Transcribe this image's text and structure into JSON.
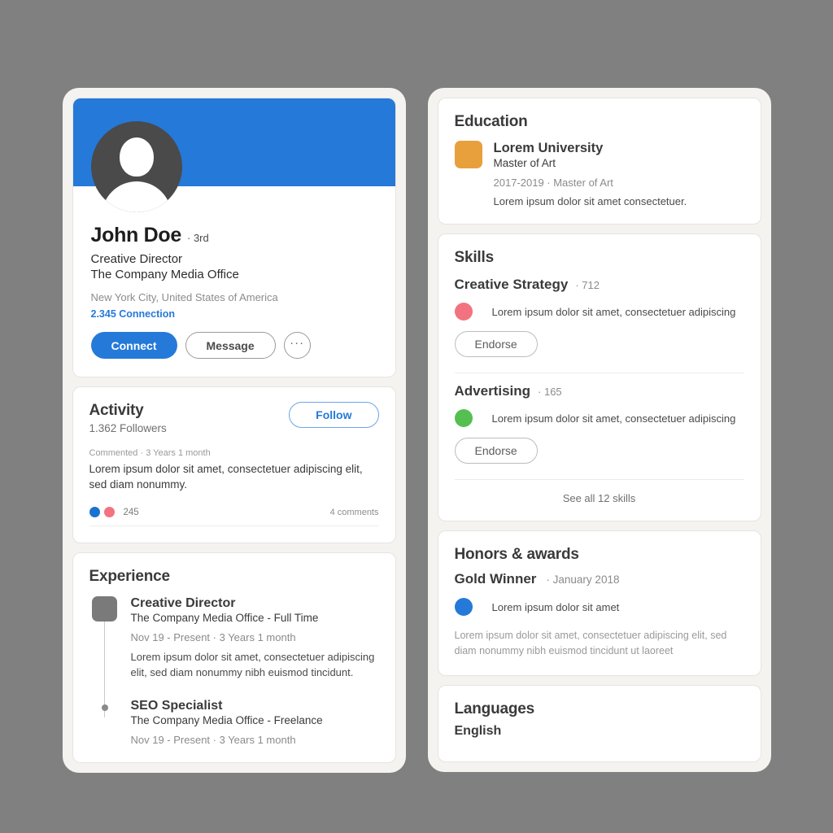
{
  "colors": {
    "brand_blue": "#2579D9",
    "page_background": "#808080",
    "panel_background": "#F4F3F0",
    "card_background": "#FFFFFF",
    "education_logo": "#E8A03C",
    "experience_logo": "#7A7A7A",
    "avatar": "#4A4A4A",
    "skill_dot_1": "#F2737F",
    "skill_dot_2": "#55BF52",
    "honor_dot": "#2579D9",
    "reaction_like": "#1A72D0",
    "reaction_love": "#F2737F"
  },
  "profile": {
    "name": "John Doe",
    "degree": "· 3rd",
    "headline_line1": "Creative Director",
    "headline_line2": "The Company Media Office",
    "location": "New York City, United States of America",
    "connections": "2.345 Connection",
    "connect_label": "Connect",
    "message_label": "Message",
    "more_label": "···"
  },
  "activity": {
    "title": "Activity",
    "follow_label": "Follow",
    "followers": "1.362 Followers",
    "meta": "Commented · 3 Years 1 month",
    "post_text": "Lorem ipsum dolor sit amet, consectetuer adipiscing elit, sed diam nonummy.",
    "reaction_count": "245",
    "comments_count": "4 comments"
  },
  "experience": {
    "title": "Experience",
    "items": [
      {
        "role": "Creative Director",
        "company": "The Company Media Office - Full Time",
        "dates": "Nov 19 - Present · 3 Years 1 month",
        "description": "Lorem ipsum dolor sit amet, consectetuer adipiscing elit, sed diam nonummy nibh euismod tincidunt."
      },
      {
        "role": "SEO Specialist",
        "company": "The Company Media Office - Freelance",
        "dates": "Nov 19 - Present · 3 Years 1 month",
        "description": ""
      }
    ]
  },
  "education": {
    "title": "Education",
    "school": "Lorem University",
    "degree": "Master of Art",
    "years": "2017-2019 · Master of Art",
    "description": "Lorem ipsum dolor sit amet consectetuer."
  },
  "skills": {
    "title": "Skills",
    "items": [
      {
        "name": "Creative Strategy",
        "count": "· 712",
        "endorsement_text": "Lorem ipsum dolor sit amet, consectetuer adipiscing",
        "endorse_label": "Endorse"
      },
      {
        "name": "Advertising",
        "count": "· 165",
        "endorsement_text": "Lorem ipsum dolor sit amet, consectetuer adipiscing",
        "endorse_label": "Endorse"
      }
    ],
    "see_all": "See all 12 skills"
  },
  "honors": {
    "title": "Honors & awards",
    "name": "Gold Winner",
    "date": "· January 2018",
    "item_text": "Lorem ipsum dolor sit amet",
    "description": "Lorem ipsum dolor sit amet, consectetuer adipiscing elit, sed diam nonummy nibh euismod tincidunt ut laoreet"
  },
  "languages": {
    "title": "Languages",
    "primary": "English"
  }
}
